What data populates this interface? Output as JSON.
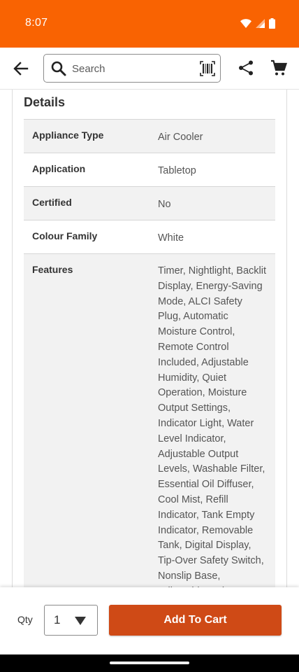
{
  "status_bar": {
    "time": "8:07",
    "icons": [
      "wifi-icon",
      "cellular-icon",
      "battery-icon"
    ],
    "background": "#f96302"
  },
  "header": {
    "search": {
      "placeholder": "Search",
      "value": ""
    },
    "icons": [
      "back-arrow-icon",
      "search-icon",
      "barcode-icon",
      "share-icon",
      "cart-icon"
    ]
  },
  "details": {
    "title": "Details",
    "rows": [
      {
        "label": "Appliance Type",
        "value": "Air Cooler"
      },
      {
        "label": "Application",
        "value": "Tabletop"
      },
      {
        "label": "Certified",
        "value": "No"
      },
      {
        "label": "Colour Family",
        "value": "White"
      },
      {
        "label": "Features",
        "value": "Timer, Nightlight, Backlit Display, Energy-Saving Mode, ALCI Safety Plug, Automatic Moisture Control, Remote Control Included, Adjustable Humidity, Quiet Operation, Moisture Output Settings, Indicator Light, Water Level Indicator, Adjustable Output Levels, Washable Filter, Essential Oil Diffuser, Cool Mist, Refill Indicator, Tank Empty Indicator, Removable Tank, Digital Display, Tip-Over Safety Switch, Nonslip Base, Adjustable Moist..."
      }
    ]
  },
  "action_bar": {
    "qty_label": "Qty",
    "qty_value": "1",
    "add_to_cart": "Add To Cart",
    "accent": "#cf4a16"
  }
}
